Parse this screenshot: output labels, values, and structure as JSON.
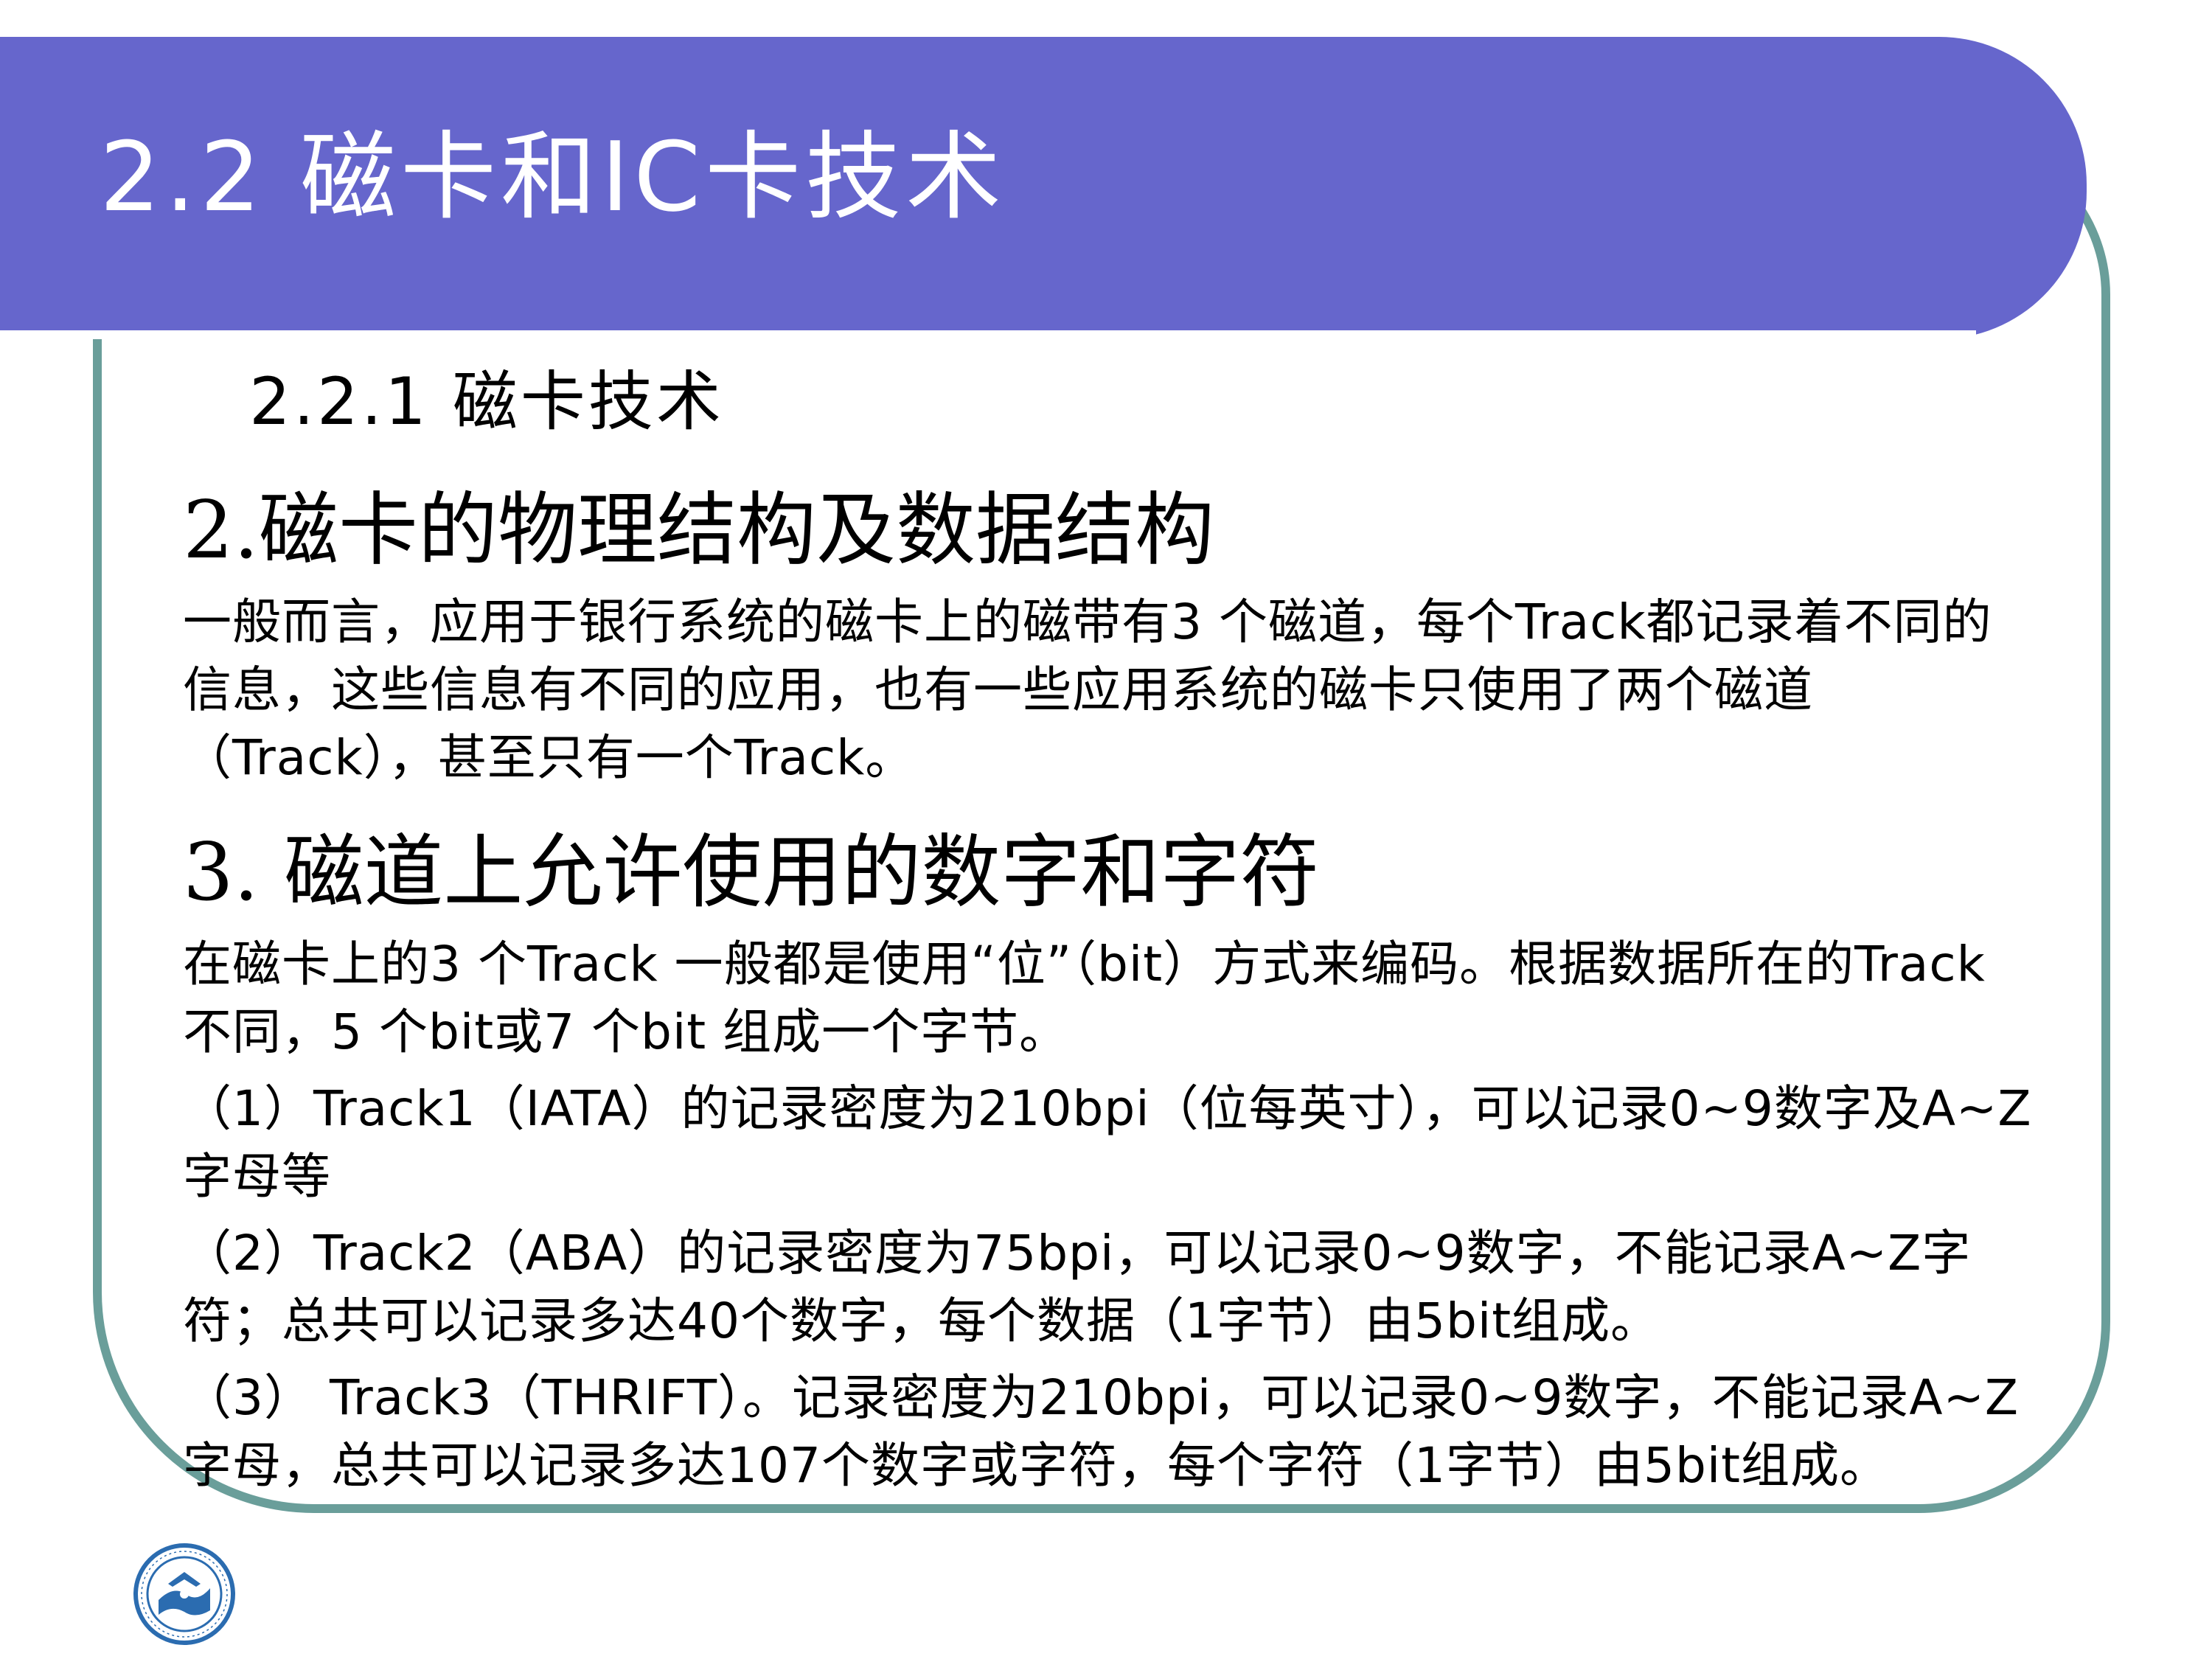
{
  "slide": {
    "title": "2.2 磁卡和IC卡技术",
    "subheading": "2.2.1 磁卡技术",
    "sections": [
      {
        "heading": "2.磁卡的物理结构及数据结构",
        "paragraphs": [
          "一般而言，应用于银行系统的磁卡上的磁带有3 个磁道，每个Track都记录着不同的信息，这些信息有不同的应用，也有一些应用系统的磁卡只使用了两个磁道（Track），甚至只有一个Track。"
        ]
      },
      {
        "heading": "3. 磁道上允许使用的数字和字符",
        "paragraphs": [
          "在磁卡上的3 个Track 一般都是使用“位”（bit）方式来编码。根据数据所在的Track 不同，5 个bit或7 个bit 组成一个字节。",
          "（1）Track1（IATA）的记录密度为210bpi（位每英寸），可以记录0~9数字及A~Z字母等",
          "（2）Track2（ABA）的记录密度为75bpi，可以记录0~9数字，不能记录A~Z字符；总共可以记录多达40个数字，每个数据（1字节）由5bit组成。",
          "（3） Track3（THRIFT）。记录密度为210bpi，可以记录0~9数字，不能记录A~Z字母，总共可以记录多达107个数字或字符，每个字符（1字节）由5bit组成。"
        ]
      }
    ]
  },
  "colors": {
    "title_bar": "#6666cc",
    "frame_border": "#6a9e9a",
    "logo_blue": "#2b6cb0"
  },
  "logo_icon": "university-seal-icon"
}
